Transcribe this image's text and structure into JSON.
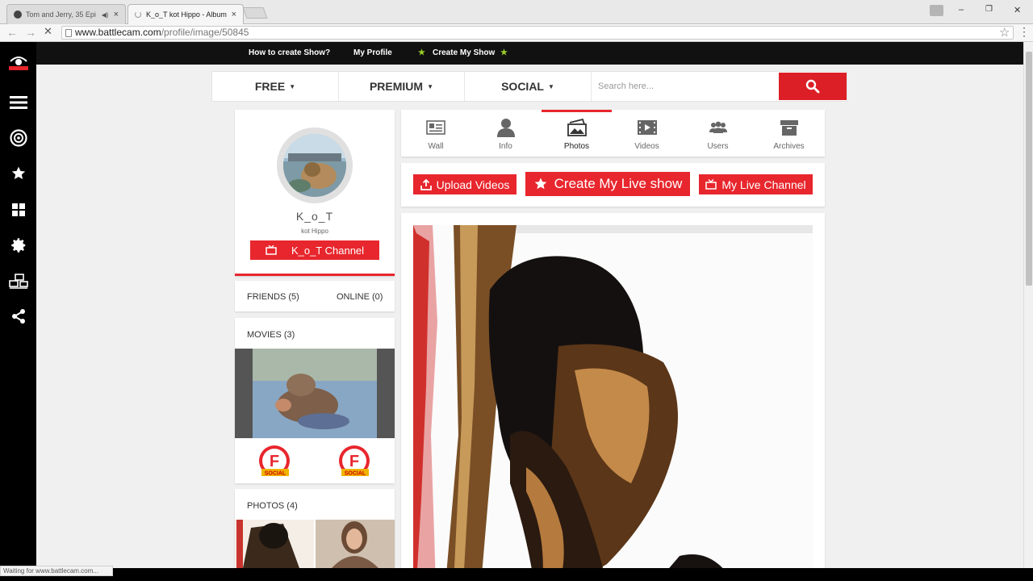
{
  "browser": {
    "tabs": [
      {
        "title": "Tom and Jerry, 35 Epi",
        "audio_icon": "◀)",
        "close": "×"
      },
      {
        "title": "K_o_T kot Hippo - Album",
        "close": "×"
      }
    ],
    "url_host": "www.battlecam.com",
    "url_path": "/profile/image/50845",
    "status_text": "Waiting for www.battlecam.com..."
  },
  "site": {
    "top_links": {
      "how_to": "How to create Show?",
      "my_profile": "My Profile",
      "create_show": "Create My Show"
    },
    "nav": {
      "free": "FREE",
      "premium": "PREMIUM",
      "social": "SOCIAL",
      "search_placeholder": "Search here..."
    },
    "sidebar_icons": [
      "menu-icon",
      "target-icon",
      "star-icon",
      "grid-icon",
      "settings-icon",
      "network-icon",
      "share-icon"
    ],
    "accent_color": "#e8262d"
  },
  "profile": {
    "name": "K_o_T",
    "subtitle": "kot Hippo",
    "channel_button": "K_o_T Channel",
    "friends": "FRIENDS (5)",
    "online": "ONLINE (0)",
    "movies_title": "MOVIES (3)",
    "photos_title": "PHOTOS (4)",
    "badge_text": "SOCIAL"
  },
  "tabs": [
    {
      "label": "Wall",
      "icon": "wall-icon"
    },
    {
      "label": "Info",
      "icon": "info-user-icon"
    },
    {
      "label": "Photos",
      "icon": "photos-icon",
      "active": true
    },
    {
      "label": "Videos",
      "icon": "videos-icon"
    },
    {
      "label": "Users",
      "icon": "users-icon"
    },
    {
      "label": "Archives",
      "icon": "archives-icon"
    }
  ],
  "actions": {
    "upload": "Upload Videos",
    "create_live": "Create My Live show",
    "my_channel": "My Live Channel"
  }
}
